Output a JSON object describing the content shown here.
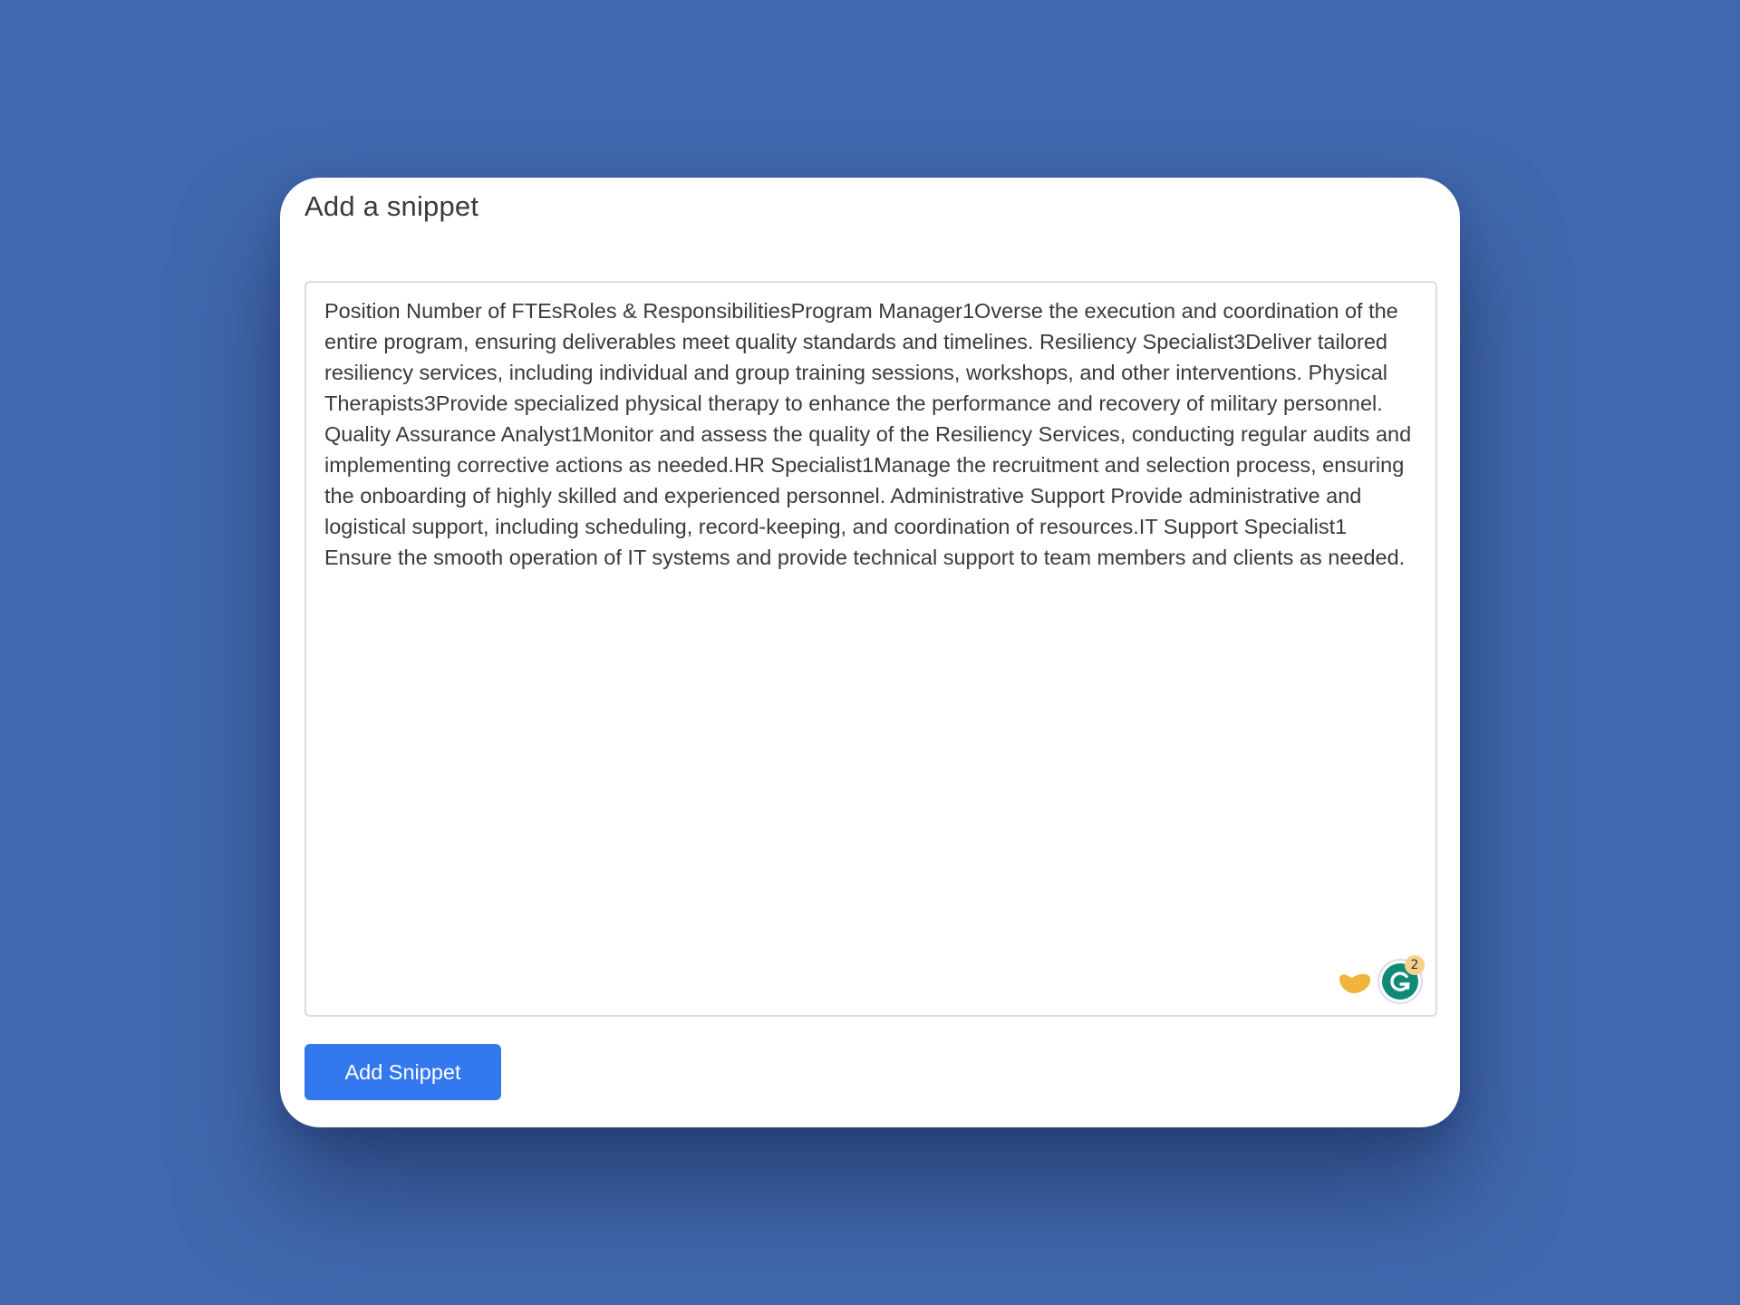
{
  "dialog": {
    "title": "Add a snippet",
    "snippet_text": "Position Number of FTEsRoles & ResponsibilitiesProgram Manager1Overse the execution and coordination of the entire program, ensuring deliverables meet quality standards and timelines. Resiliency Specialist3Deliver tailored resiliency services, including individual and group training sessions, workshops, and other interventions. Physical Therapists3Provide specialized physical therapy to enhance the performance and recovery of military personnel. Quality Assurance Analyst1Monitor and assess the quality of the Resiliency Services, conducting regular audits and implementing corrective actions as needed.HR Specialist1Manage the recruitment and selection process, ensuring the onboarding of highly skilled and experienced personnel. Administrative Support Provide administrative and logistical support, including scheduling, record-keeping, and coordination of resources.IT Support Specialist1 Ensure the smooth operation of IT systems and provide technical support to team members and clients as needed.",
    "submit_label": "Add Snippet"
  },
  "extensions": {
    "hand_icon": "yellow-hand-icon",
    "grammarly_icon": "grammarly-g-icon",
    "grammarly_badge_count": "2"
  },
  "colors": {
    "background": "#4168ae",
    "card": "#ffffff",
    "button": "#3478f0",
    "grammarly": "#0f8a77",
    "badge": "#f7d08a",
    "hand": "#f2b53c"
  }
}
